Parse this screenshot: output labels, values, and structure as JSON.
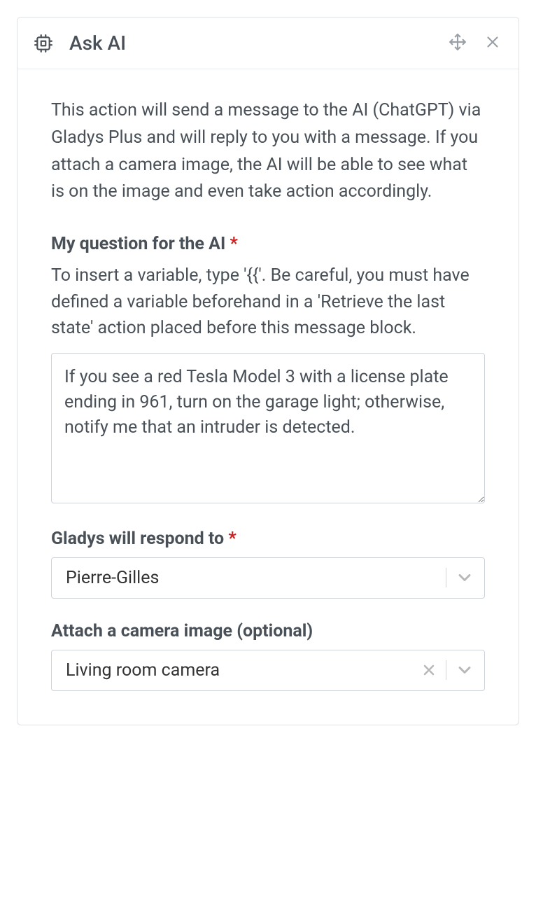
{
  "header": {
    "title": "Ask AI"
  },
  "description": "This action will send a message to the AI (ChatGPT) via Gladys Plus and will reply to you with a message. If you attach a camera image, the AI will be able to see what is on the image and even take action accordingly.",
  "question": {
    "label": "My question for the AI",
    "required": true,
    "help": "To insert a variable, type '{{'. Be careful, you must have defined a variable beforehand in a 'Retrieve the last state' action placed before this message block.",
    "value": "If you see a red Tesla Model 3 with a license plate ending in 961, turn on the garage light; otherwise, notify me that an intruder is detected."
  },
  "respond_to": {
    "label": "Gladys will respond to",
    "required": true,
    "value": "Pierre-Gilles"
  },
  "camera": {
    "label": "Attach a camera image (optional)",
    "required": false,
    "value": "Living room camera"
  }
}
